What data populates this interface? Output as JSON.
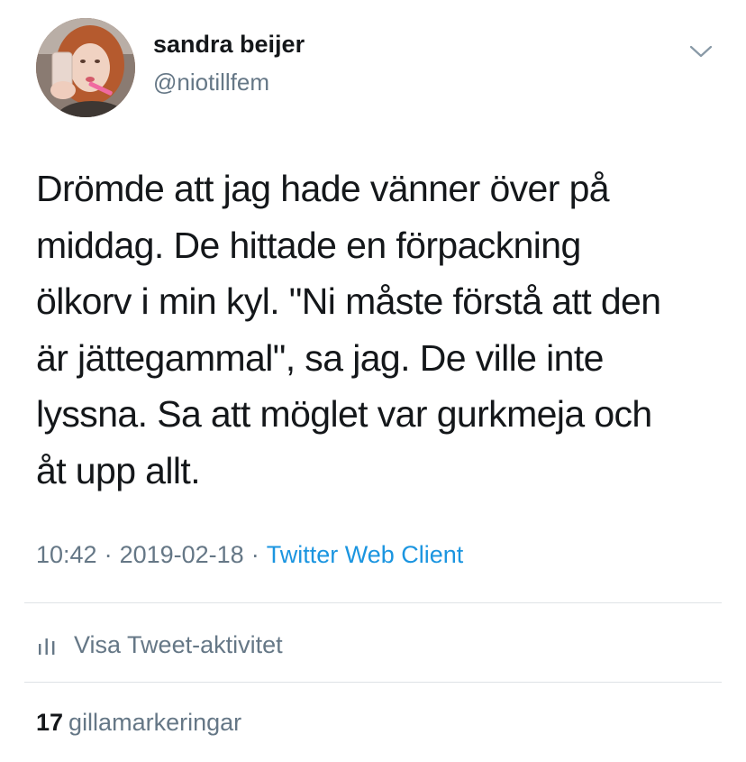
{
  "header": {
    "display_name": "sandra beijer",
    "handle": "@niotillfem"
  },
  "tweet": {
    "text": "Drömde att jag hade vänner över på\nmiddag. De hittade en förpackning\nölkorv i min kyl. \"Ni måste förstå att den\när jättegammal\", sa jag. De ville inte\nlyssna. Sa att möglet var gurkmeja och\nåt upp allt."
  },
  "meta": {
    "time": "10:42",
    "separator": "·",
    "date": "2019-02-18",
    "client": "Twitter Web Client"
  },
  "activity": {
    "label": "Visa Tweet-aktivitet",
    "icon": "bar-chart-icon"
  },
  "likes": {
    "count": "17",
    "label": "gillamarkeringar"
  },
  "icons": {
    "caret": "chevron-down-icon",
    "avatar": "avatar"
  },
  "colors": {
    "text_primary": "#14171a",
    "text_secondary": "#657786",
    "link": "#1b95e0",
    "divider": "#dfe3e6"
  }
}
